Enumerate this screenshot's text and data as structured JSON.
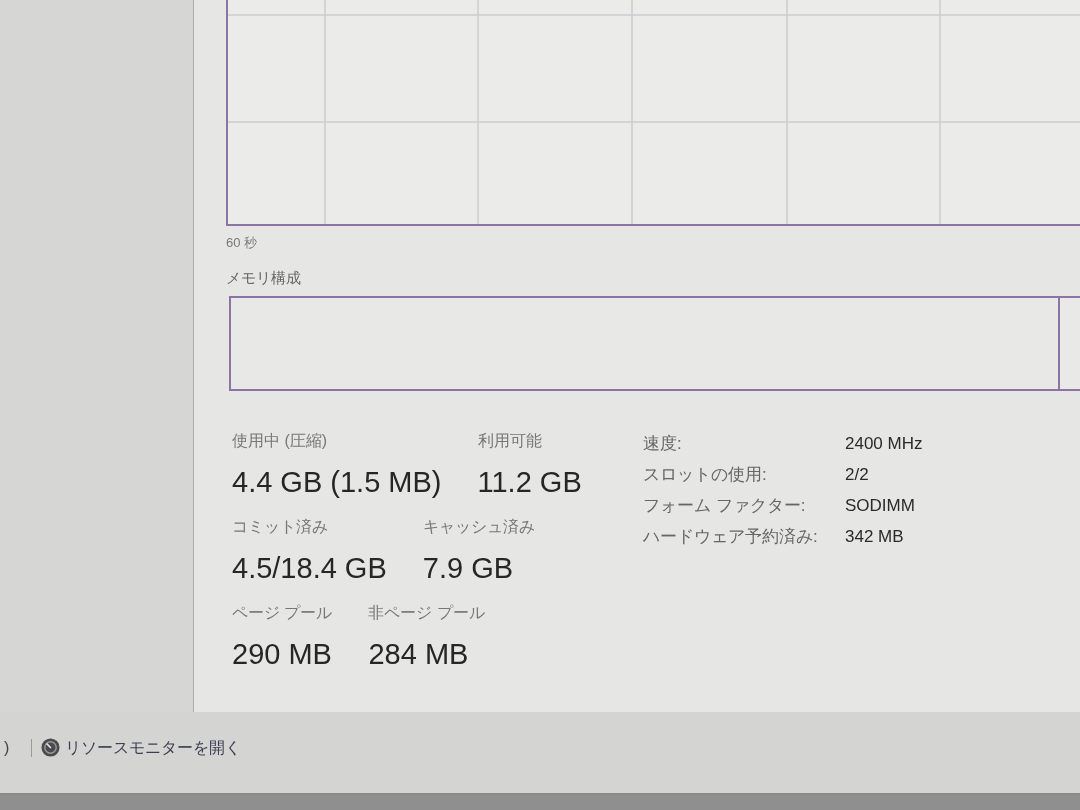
{
  "performance_graph": {
    "time_span": "60 秒"
  },
  "memory_composition": {
    "title": "メモリ構成"
  },
  "stat_rows": [
    {
      "items": [
        {
          "label": "使用中 (圧縮)",
          "value": "4.4 GB (1.5 MB)"
        },
        {
          "label": "利用可能",
          "value": "11.2 GB"
        }
      ]
    },
    {
      "items": [
        {
          "label": "コミット済み",
          "value": "4.5/18.4 GB"
        },
        {
          "label": "キャッシュ済み",
          "value": "7.9 GB"
        }
      ]
    },
    {
      "items": [
        {
          "label": "ページ プール",
          "value": "290 MB"
        },
        {
          "label": "非ページ プール",
          "value": "284 MB"
        }
      ]
    }
  ],
  "hardware": [
    {
      "label": "速度:",
      "value": "2400 MHz"
    },
    {
      "label": "スロットの使用:",
      "value": "2/2"
    },
    {
      "label": "フォーム ファクター:",
      "value": "SODIMM"
    },
    {
      "label": "ハードウェア予約済み:",
      "value": "342 MB"
    }
  ],
  "footer": {
    "cut_off_link": ")",
    "resource_monitor_link": "リソースモニターを開く"
  }
}
